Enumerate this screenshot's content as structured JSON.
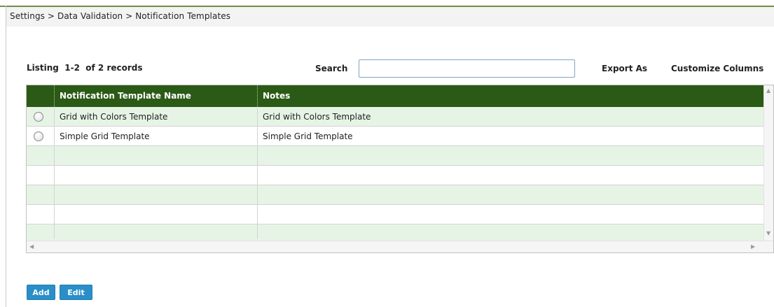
{
  "breadcrumb": "Settings > Data Validation > Notification Templates",
  "listing": {
    "text": "Listing  1-2  of 2 records"
  },
  "search": {
    "label": "Search",
    "value": "",
    "placeholder": ""
  },
  "toolbar": {
    "export_label": "Export As",
    "customize_label": "Customize Columns"
  },
  "grid": {
    "columns": [
      "Notification Template Name",
      "Notes"
    ],
    "rows": [
      {
        "name": "Grid with Colors Template",
        "notes": "Grid with Colors Template",
        "selected": false
      },
      {
        "name": "Simple Grid Template",
        "notes": "Simple Grid Template",
        "selected": false
      }
    ]
  },
  "buttons": {
    "add_label": "Add",
    "edit_label": "Edit"
  },
  "colors": {
    "header_bg": "#2b5a16",
    "alt_row_bg": "#e6f4e6",
    "button_bg": "#2a8fc8",
    "top_accent": "#6f8f4a"
  },
  "icons": {
    "scroll_up": "triangle-up-icon",
    "scroll_down": "triangle-down-icon",
    "scroll_left": "triangle-left-icon",
    "scroll_right": "triangle-right-icon",
    "radio": "radio-button-icon"
  }
}
